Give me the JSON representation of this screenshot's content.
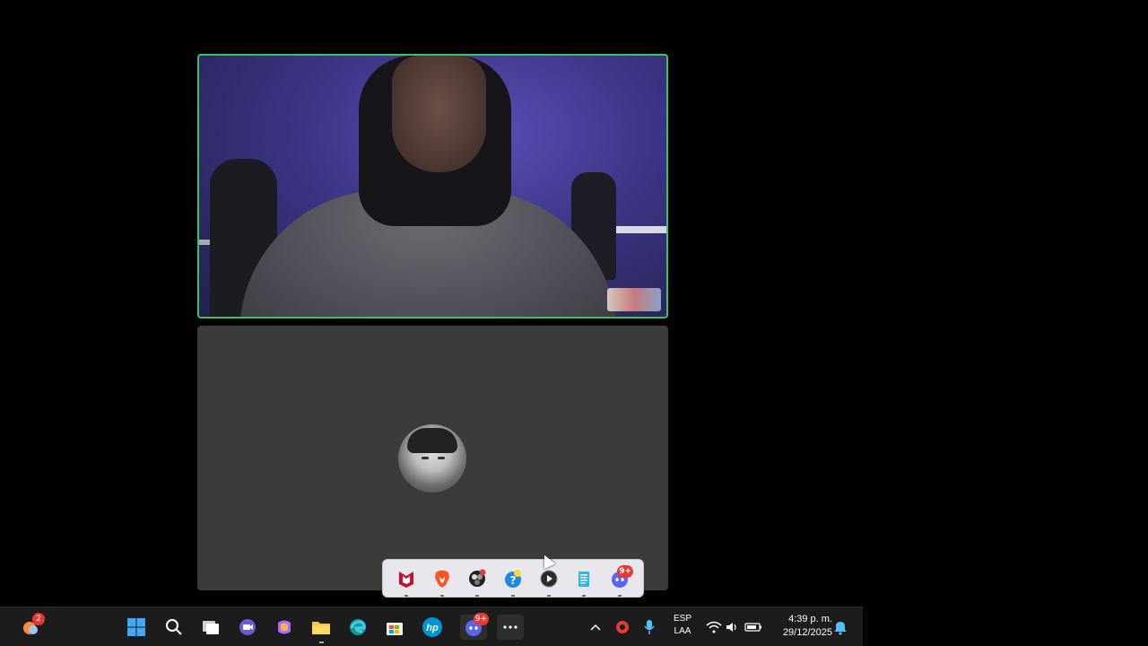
{
  "call": {
    "participant_video": {
      "border_color": "#3fbf6a"
    },
    "participant_avatar": {}
  },
  "tray": {
    "icons": [
      "mcafee-icon",
      "brave-icon",
      "obs-icon",
      "help-icon",
      "media-player-icon",
      "notepad-icon",
      "discord-icon"
    ],
    "discord_badge": "9+"
  },
  "taskbar": {
    "weather_badge": "2",
    "discord_badge": "9+",
    "language_line1": "ESP",
    "language_line2": "LAA",
    "time": "4:39 p. m.",
    "date": "29/12/2025"
  },
  "colors": {
    "taskbar_bg": "#1c1c1c",
    "tile_bg": "#3b3b3b",
    "speaking_border": "#3fbf6a"
  }
}
